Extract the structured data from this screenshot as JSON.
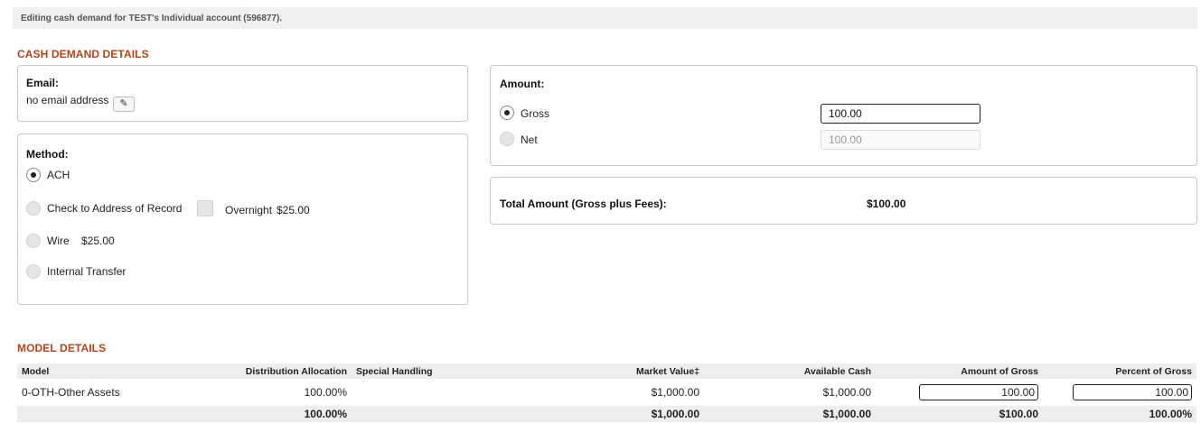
{
  "banner": "Editing cash demand for TEST's Individual account (596877).",
  "cash_demand": {
    "section_title": "CASH DEMAND DETAILS",
    "email": {
      "label": "Email:",
      "value": "no email address",
      "edit_icon": "pencil-icon",
      "edit_glyph": "✎"
    },
    "method": {
      "label": "Method:",
      "options": [
        {
          "label": "ACH",
          "selected": true
        },
        {
          "label": "Check to Address of Record",
          "selected": false
        },
        {
          "label": "Wire",
          "fee": "$25.00",
          "selected": false
        },
        {
          "label": "Internal Transfer",
          "selected": false
        }
      ],
      "overnight": {
        "label": "Overnight",
        "fee": "$25.00",
        "checked": false
      }
    },
    "amount": {
      "label": "Amount:",
      "gross": {
        "label": "Gross",
        "value": "100.00",
        "selected": true
      },
      "net": {
        "label": "Net",
        "value": "100.00",
        "selected": false
      }
    },
    "total": {
      "label": "Total Amount (Gross plus Fees):",
      "value": "$100.00"
    }
  },
  "model_details": {
    "section_title": "MODEL DETAILS",
    "columns": [
      "Model",
      "Distribution Allocation",
      "Special Handling",
      "Market Value‡",
      "Available Cash",
      "Amount of Gross",
      "Percent of Gross"
    ],
    "rows": [
      {
        "model": "0-OTH-Other Assets",
        "allocation": "100.00%",
        "special_handling": "",
        "market_value": "$1,000.00",
        "available_cash": "$1,000.00",
        "amount_of_gross": "100.00",
        "percent_of_gross": "100.00"
      }
    ],
    "totals": {
      "model": "",
      "allocation": "100.00%",
      "special_handling": "",
      "market_value": "$1,000.00",
      "available_cash": "$1,000.00",
      "amount_of_gross": "$100.00",
      "percent_of_gross": "100.00%"
    }
  }
}
